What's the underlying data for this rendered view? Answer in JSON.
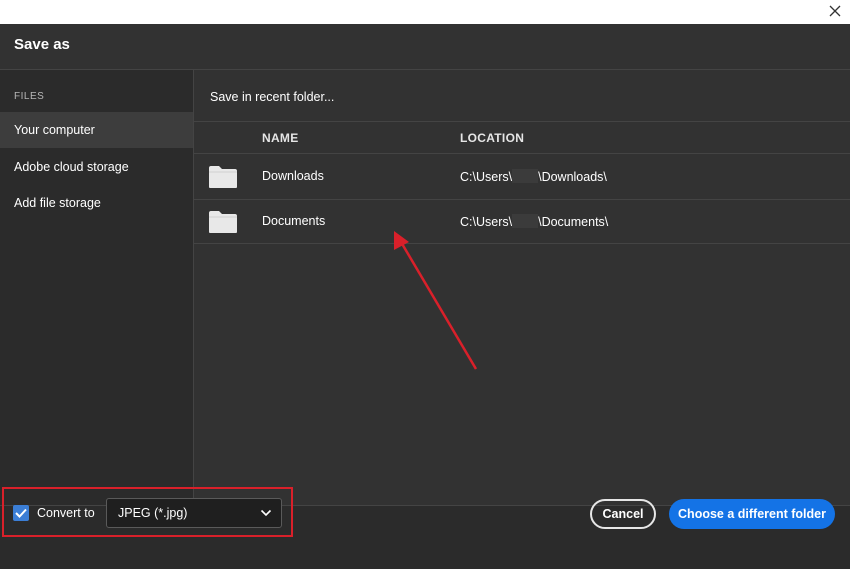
{
  "dialog": {
    "title": "Save as"
  },
  "sidebar": {
    "section_label": "FILES",
    "items": [
      {
        "label": "Your computer",
        "active": true
      },
      {
        "label": "Adobe cloud storage",
        "active": false
      },
      {
        "label": "Add file storage",
        "active": false
      }
    ]
  },
  "main": {
    "recent_label": "Save in recent folder...",
    "columns": {
      "name": "NAME",
      "location": "LOCATION"
    },
    "rows": [
      {
        "name": "Downloads",
        "loc_prefix": "C:\\Users\\",
        "loc_suffix": "\\Downloads\\",
        "icon": "folder-icon"
      },
      {
        "name": "Documents",
        "loc_prefix": "C:\\Users\\",
        "loc_suffix": "\\Documents\\",
        "icon": "folder-icon"
      }
    ]
  },
  "footer": {
    "convert_checked": true,
    "convert_label": "Convert to",
    "format_selected": "JPEG (*.jpg)",
    "cancel_label": "Cancel",
    "choose_label": "Choose a different folder"
  },
  "colors": {
    "dialog_bg": "#323232",
    "sidebar_bg": "#2b2b2b",
    "accent_blue": "#1473e6",
    "annotation_red": "#d9202a"
  }
}
